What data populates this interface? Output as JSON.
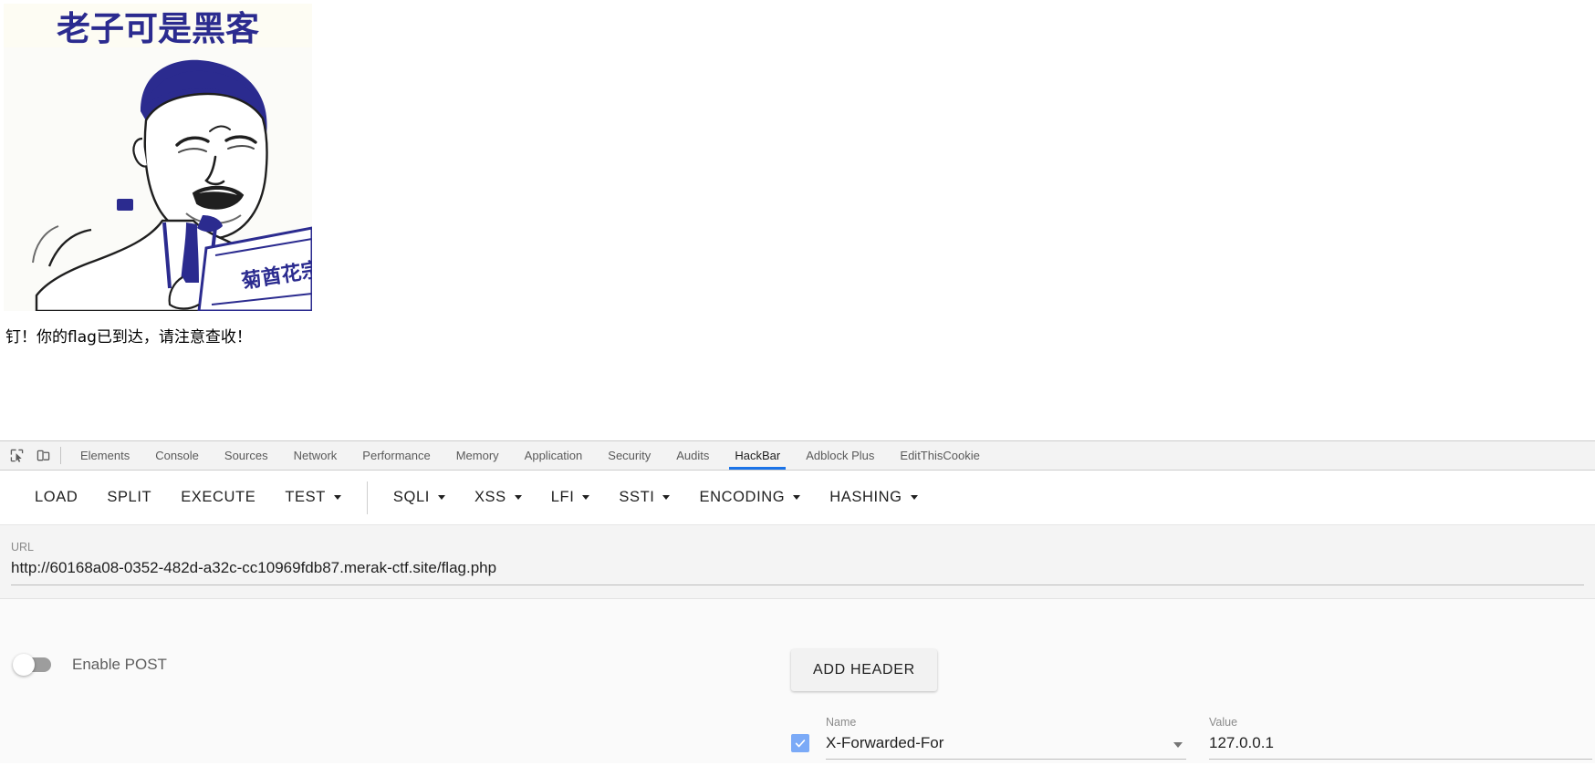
{
  "page": {
    "meme": {
      "caption": "老子可是黑客",
      "book_text": "菊酋花宗",
      "alt_name": "hacker-meme-image",
      "ink_color": "#2b2b8f",
      "bg_color": "#fdfcf3"
    },
    "flag_text": "钉！你的flag已到达，请注意查收！"
  },
  "devtools": {
    "icons": {
      "inspect": "inspect-element-icon",
      "device": "device-toolbar-icon"
    },
    "tabs": [
      {
        "label": "Elements",
        "active": false
      },
      {
        "label": "Console",
        "active": false
      },
      {
        "label": "Sources",
        "active": false
      },
      {
        "label": "Network",
        "active": false
      },
      {
        "label": "Performance",
        "active": false
      },
      {
        "label": "Memory",
        "active": false
      },
      {
        "label": "Application",
        "active": false
      },
      {
        "label": "Security",
        "active": false
      },
      {
        "label": "Audits",
        "active": false
      },
      {
        "label": "HackBar",
        "active": true
      },
      {
        "label": "Adblock Plus",
        "active": false
      },
      {
        "label": "EditThisCookie",
        "active": false
      }
    ],
    "active_tab_color": "#1a73e8"
  },
  "hackbar": {
    "menu_group_1": [
      {
        "label": "LOAD",
        "caret": false
      },
      {
        "label": "SPLIT",
        "caret": false
      },
      {
        "label": "EXECUTE",
        "caret": false
      },
      {
        "label": "TEST",
        "caret": true
      }
    ],
    "menu_group_2": [
      {
        "label": "SQLI",
        "caret": true
      },
      {
        "label": "XSS",
        "caret": true
      },
      {
        "label": "LFI",
        "caret": true
      },
      {
        "label": "SSTI",
        "caret": true
      },
      {
        "label": "ENCODING",
        "caret": true
      },
      {
        "label": "HASHING",
        "caret": true
      }
    ],
    "url": {
      "label": "URL",
      "value": "http://60168a08-0352-482d-a32c-cc10969fdb87.merak-ctf.site/flag.php",
      "placeholder": "URL"
    },
    "post": {
      "toggle_label": "Enable POST",
      "enabled": false
    },
    "add_header_label": "ADD HEADER",
    "headers": [
      {
        "enabled": true,
        "name_label": "Name",
        "name_value": "X-Forwarded-For",
        "value_label": "Value",
        "value_value": "127.0.0.1"
      }
    ],
    "checkbox_color": "#7baaf7"
  }
}
